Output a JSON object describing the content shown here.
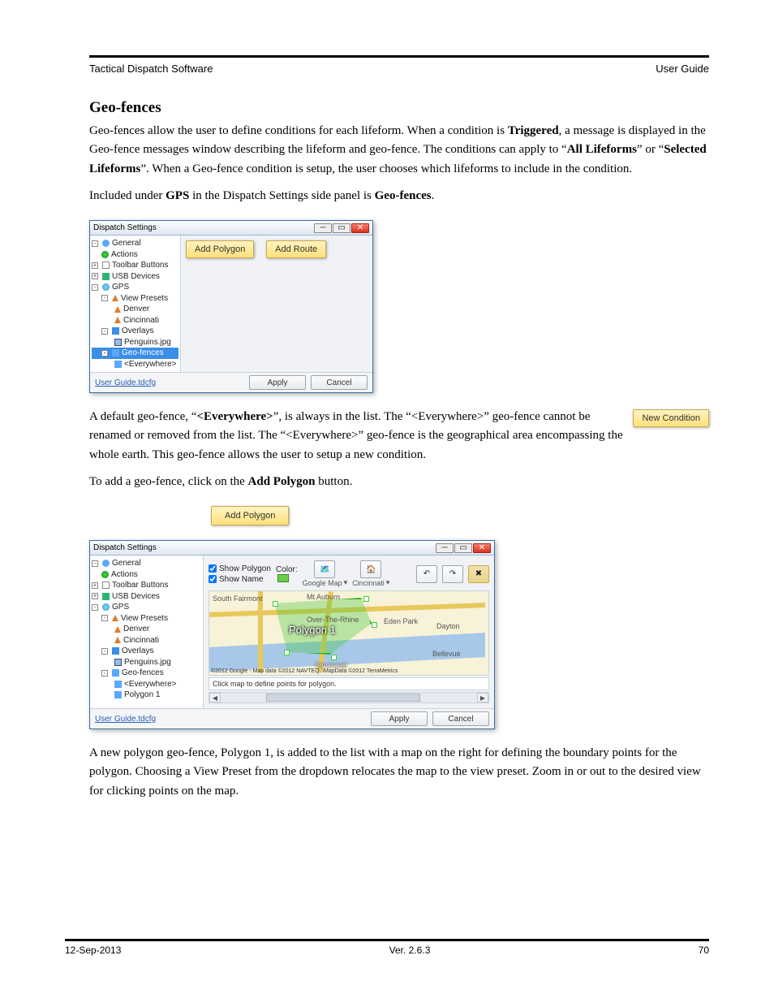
{
  "header": {
    "left": "Tactical Dispatch Software",
    "right": "User Guide"
  },
  "section_title": "Geo-fences",
  "paragraphs": {
    "p1_a": "Geo-fences allow the user to define conditions for each lifeform. When a condition is ",
    "p1_b": "Triggered",
    "p1_c": ", a message is displayed in the Geo-fence messages window describing the lifeform and geo-fence.  The conditions can apply to “",
    "p1_d": "All Lifeforms",
    "p1_e": "” or “",
    "p1_f": "Selected Lifeforms",
    "p1_g": "”.  When a Geo-fence condition is setup, the user chooses which lifeforms to include in the condition.",
    "p2_a": "Included under ",
    "p2_b": "GPS",
    "p2_c": " in the Dispatch Settings side panel is ",
    "p2_d": "Geo-fences",
    "p2_e": ".",
    "p3_a": "A default geo-fence, “",
    "p3_b": "<Everywhere>",
    "p3_c": "”, is always in the list.  The “<Everywhere>” geo-fence cannot be renamed or removed from the list.  The “<Everywhere>” geo-fence is the geographical area encompassing the whole earth.  This geo-fence allows the user to setup a new condition.",
    "p4_a": "To add a geo-fence, click on the ",
    "p4_b": "Add Polygon",
    "p4_c": " button.",
    "p5": "A new polygon geo-fence, Polygon 1, is added to the list with a map on the right for defining the boundary points for the polygon. Choosing a View Preset from the dropdown relocates the map to the view preset.  Zoom in or out to the desired view for clicking points on the map."
  },
  "buttons": {
    "new_condition": "New Condition",
    "add_polygon_inline": "Add Polygon"
  },
  "win1": {
    "title": "Dispatch Settings",
    "add_polygon": "Add Polygon",
    "add_route": "Add Route",
    "apply": "Apply",
    "cancel": "Cancel",
    "link": "User Guide.tdcfg",
    "tree": {
      "general": "General",
      "actions": "Actions",
      "toolbar": "Toolbar Buttons",
      "usb": "USB Devices",
      "gps": "GPS",
      "viewpresets": "View Presets",
      "denver": "Denver",
      "cincinnati": "Cincinnati",
      "overlays": "Overlays",
      "penguins": "Penguins.jpg",
      "geofences": "Geo-fences",
      "everywhere": "<Everywhere>"
    }
  },
  "win2": {
    "title": "Dispatch Settings",
    "show_polygon": "Show Polygon",
    "show_name": "Show Name",
    "color": "Color:",
    "google_map": "Google Map",
    "preset": "Cincinnati",
    "status": "Click map to define points for polygon.",
    "apply": "Apply",
    "cancel": "Cancel",
    "link": "User Guide.tdcfg",
    "polygon_label": "Polygon 1",
    "attribution": "©2012 Google - Map data ©2012 NAVTEQ, iMapData ©2012 TerraMetrics",
    "map_labels": {
      "fairmont": "South Fairmont",
      "mtauburn": "Mt Auburn",
      "cincinnati": "Cincinnati",
      "edenpark": "Eden Park",
      "dayton": "Dayton",
      "bellevue": "Bellevue",
      "otr": "Over-The-Rhine"
    },
    "tree_extra": {
      "polygon1": "Polygon 1"
    }
  },
  "footer": {
    "date": "12-Sep-2013",
    "ver": "Ver. 2.6.3",
    "page": "70"
  }
}
